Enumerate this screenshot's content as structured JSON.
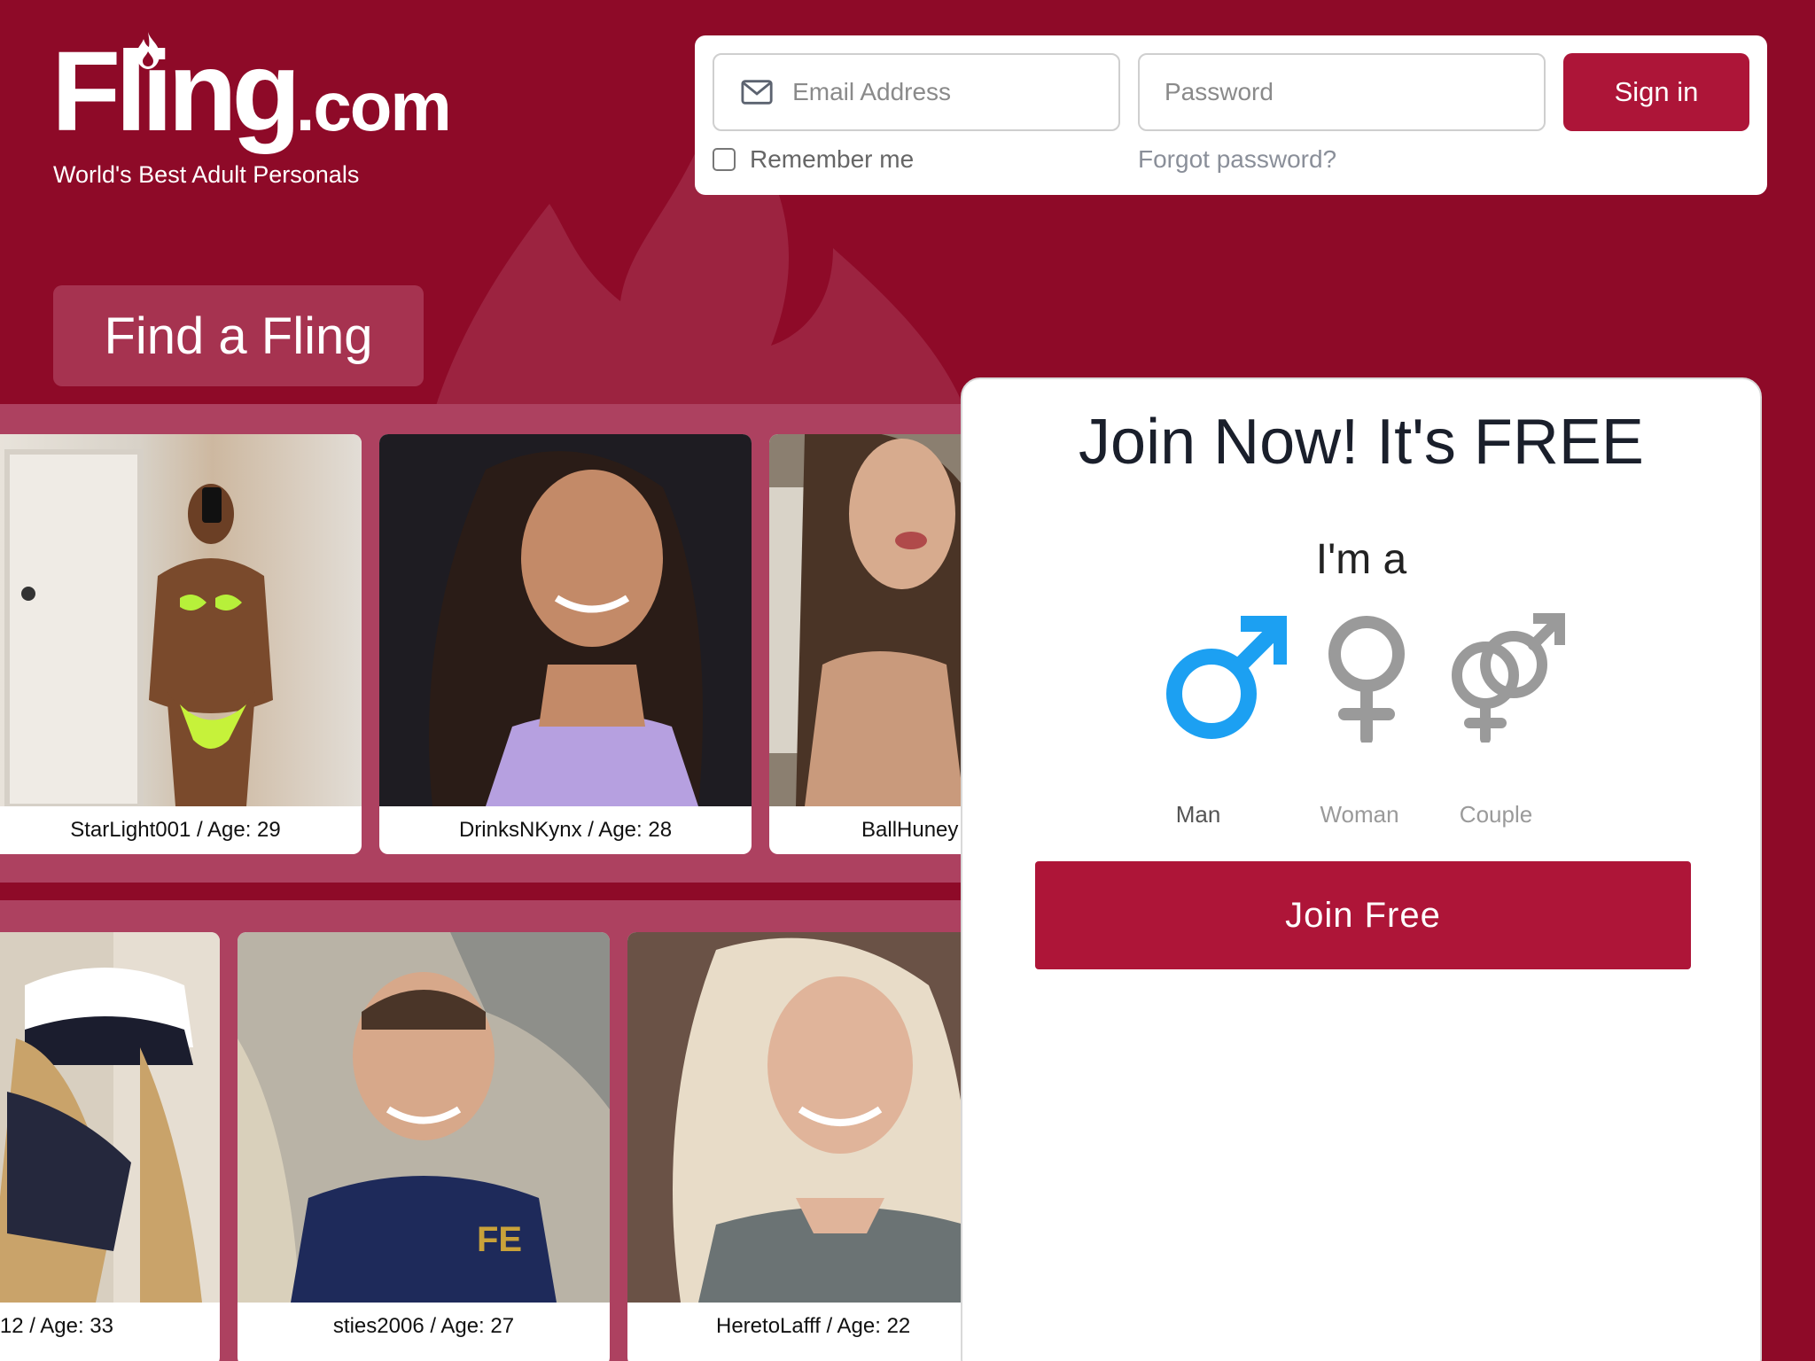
{
  "brand": {
    "logo_text": "Fling",
    "logo_suffix": ".com",
    "tagline": "World's Best Adult Personals"
  },
  "login": {
    "email_placeholder": "Email Address",
    "password_placeholder": "Password",
    "signin_label": "Sign in",
    "remember_label": "Remember me",
    "forgot_label": "Forgot password?"
  },
  "find_label": "Find a Fling",
  "profiles_row1": [
    {
      "caption": "StarLight001 / Age: 29"
    },
    {
      "caption": "DrinksNKynx / Age: 28"
    },
    {
      "caption": "BallHuney"
    }
  ],
  "profiles_row2": [
    {
      "caption": "12 / Age: 33"
    },
    {
      "caption": "sties2006 / Age: 27"
    },
    {
      "caption": "HeretoLafff / Age: 22"
    }
  ],
  "join": {
    "title": "Join Now! It's FREE",
    "im_a": "I'm a",
    "genders": [
      {
        "label": "Man",
        "icon": "male-icon",
        "selected": true
      },
      {
        "label": "Woman",
        "icon": "female-icon",
        "selected": false
      },
      {
        "label": "Couple",
        "icon": "couple-icon",
        "selected": false
      }
    ],
    "button_label": "Join Free"
  },
  "colors": {
    "background": "#8e0a28",
    "accent": "#ad1538",
    "male_selected": "#1ca0f2",
    "unselected_icon": "#9a9a9a"
  }
}
